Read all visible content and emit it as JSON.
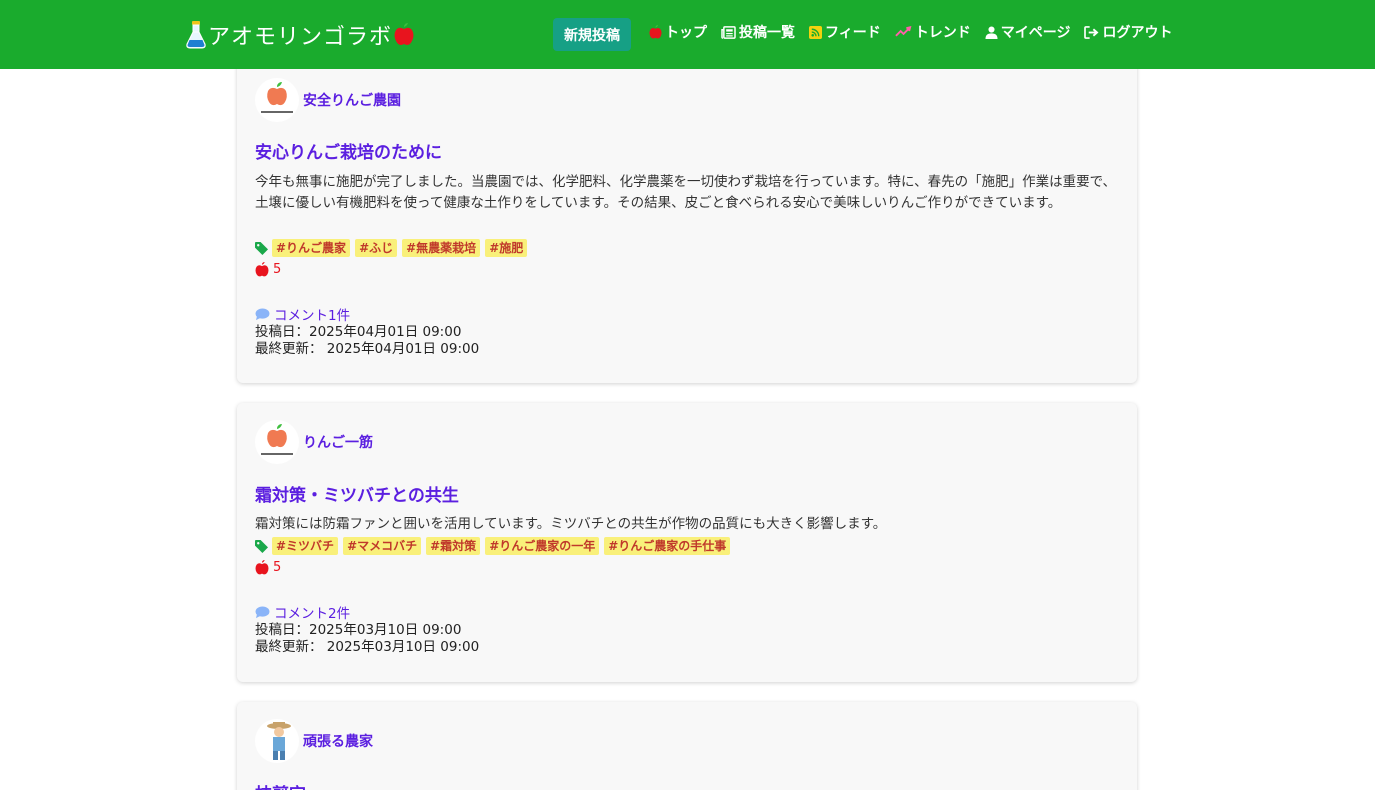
{
  "header": {
    "brand": "アオモリンゴラボ",
    "new_post_label": "新規投稿",
    "nav": [
      {
        "label": "トップ",
        "icon": "apple-icon"
      },
      {
        "label": "投稿一覧",
        "icon": "newspaper-icon"
      },
      {
        "label": "フィード",
        "icon": "rss-icon"
      },
      {
        "label": "トレンド",
        "icon": "trend-icon"
      },
      {
        "label": "マイページ",
        "icon": "user-icon"
      },
      {
        "label": "ログアウト",
        "icon": "logout-icon"
      }
    ]
  },
  "posts": [
    {
      "author": "安全りんご農園",
      "title": "安心りんご栽培のために",
      "body": "今年も無事に施肥が完了しました。当農園では、化学肥料、化学農薬を一切使わず栽培を行っています。特に、春先の「施肥」作業は重要で、土壌に優しい有機肥料を使って健康な土作りをしています。その結果、皮ごと食べられる安心で美味しいりんご作りができています。",
      "tags": [
        "#りんご農家",
        "#ふじ",
        "#無農薬栽培",
        "#施肥"
      ],
      "likes": "5",
      "comments": "コメント1件",
      "posted": "投稿日：2025年04月01日 09:00",
      "updated": "最終更新： 2025年04月01日 09:00"
    },
    {
      "author": "りんご一筋",
      "title": "霜対策・ミツバチとの共生",
      "body": "霜対策には防霜ファンと囲いを活用しています。ミツバチとの共生が作物の品質にも大きく影響します。",
      "tags": [
        "#ミツバチ",
        "#マメコバチ",
        "#霜対策",
        "#りんご農家の一年",
        "#りんご農家の手仕事"
      ],
      "likes": "5",
      "comments": "コメント2件",
      "posted": "投稿日：2025年03月10日 09:00",
      "updated": "最終更新： 2025年03月10日 09:00"
    },
    {
      "author": "頑張る農家",
      "title": "枝剪定"
    }
  ],
  "colors": {
    "header_bg": "#1aab2d",
    "new_post_bg": "#16a085",
    "link": "#5b1fe0",
    "tag_bg": "#f9f07a",
    "tag_text": "#c0392b",
    "like": "#e8141e"
  }
}
